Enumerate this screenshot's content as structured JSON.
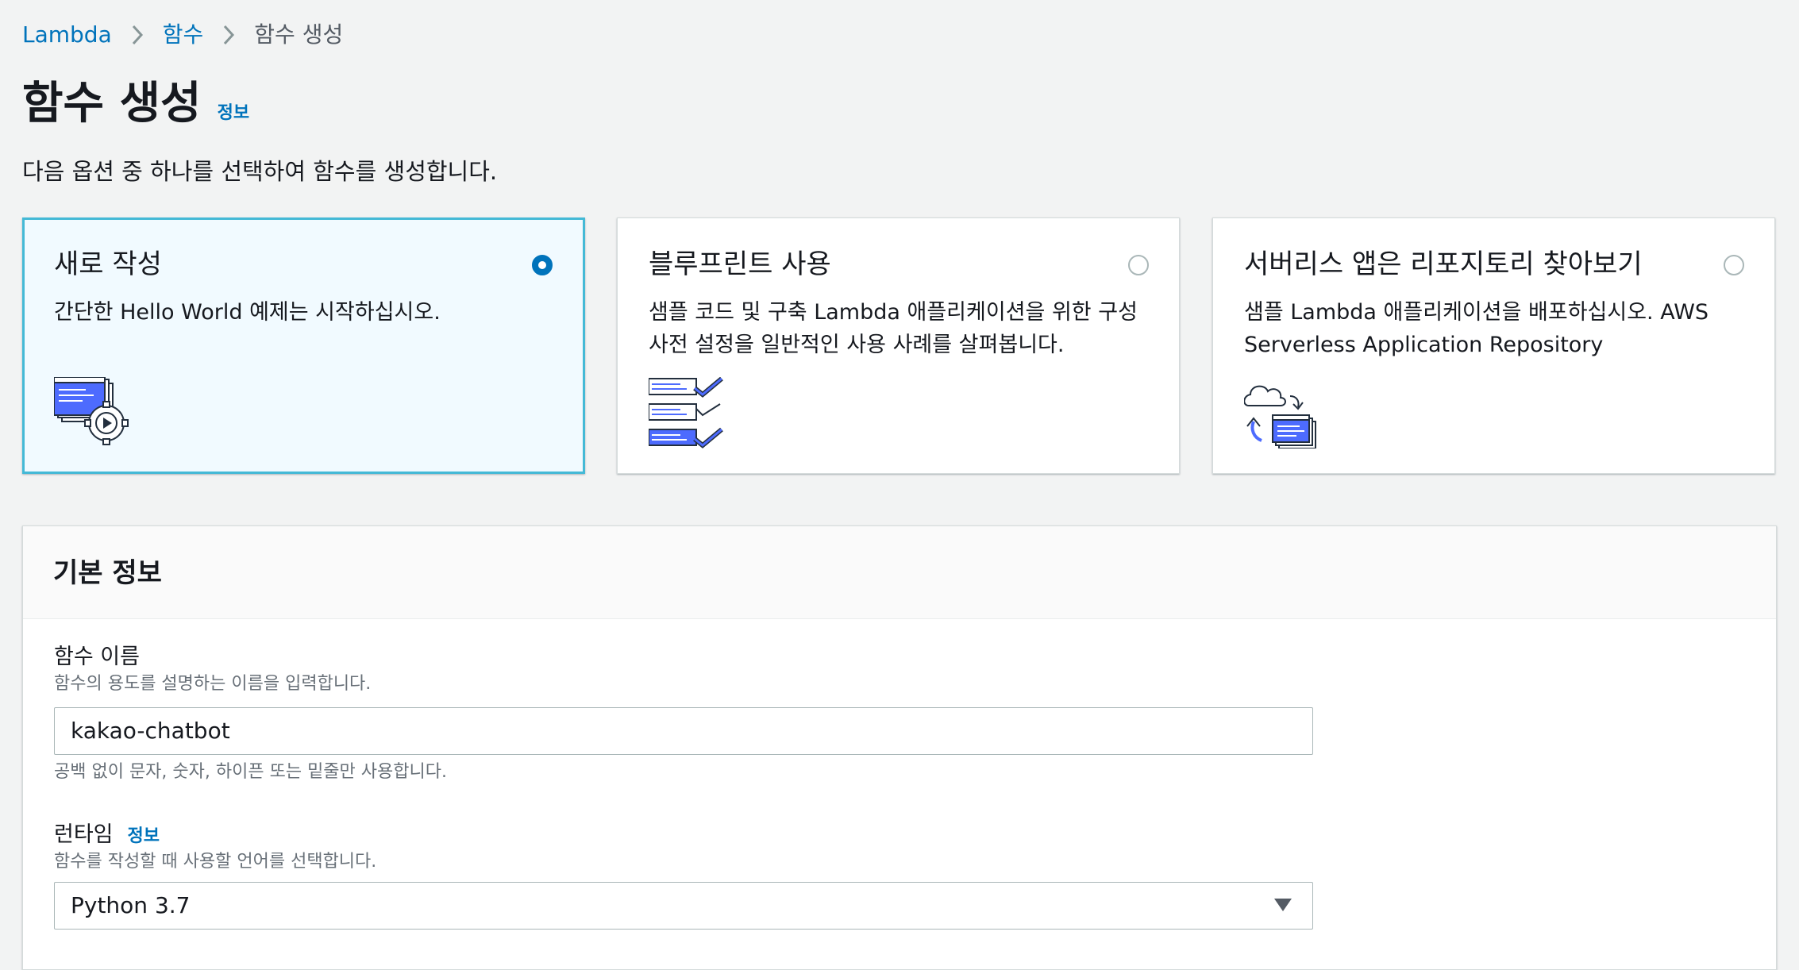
{
  "breadcrumb": [
    {
      "label": "Lambda",
      "link": true
    },
    {
      "label": "함수",
      "link": true
    },
    {
      "label": "함수 생성",
      "link": false
    }
  ],
  "page": {
    "title": "함수 생성",
    "info_link": "정보",
    "description": "다음 옵션 중 하나를 선택하여 함수를 생성합니다."
  },
  "options": [
    {
      "title": "새로 작성",
      "description": "간단한 Hello World 예제는 시작하십시오.",
      "selected": true,
      "icon": "author-from-scratch-icon"
    },
    {
      "title": "블루프린트 사용",
      "description": "샘플 코드 및 구축 Lambda 애플리케이션을 위한 구성 사전 설정을 일반적인 사용 사례를 살펴봅니다.",
      "selected": false,
      "icon": "blueprint-icon"
    },
    {
      "title": "서버리스 앱은 리포지토리 찾아보기",
      "description": "샘플 Lambda 애플리케이션을 배포하십시오. AWS Serverless Application Repository",
      "selected": false,
      "icon": "serverless-repo-icon"
    }
  ],
  "basic_info": {
    "title": "기본 정보",
    "function_name": {
      "label": "함수 이름",
      "hint": "함수의 용도를 설명하는 이름을 입력합니다.",
      "value": "kakao-chatbot",
      "constraint": "공백 없이 문자, 숫자, 하이픈 또는 밑줄만 사용합니다."
    },
    "runtime": {
      "label": "런타임",
      "info_link": "정보",
      "hint": "함수를 작성할 때 사용할 언어를 선택합니다.",
      "selected": "Python 3.7"
    }
  },
  "colors": {
    "link": "#0073bb",
    "selected_border": "#44b9d6",
    "selected_bg": "#f1faff",
    "page_bg": "#f2f3f3"
  }
}
